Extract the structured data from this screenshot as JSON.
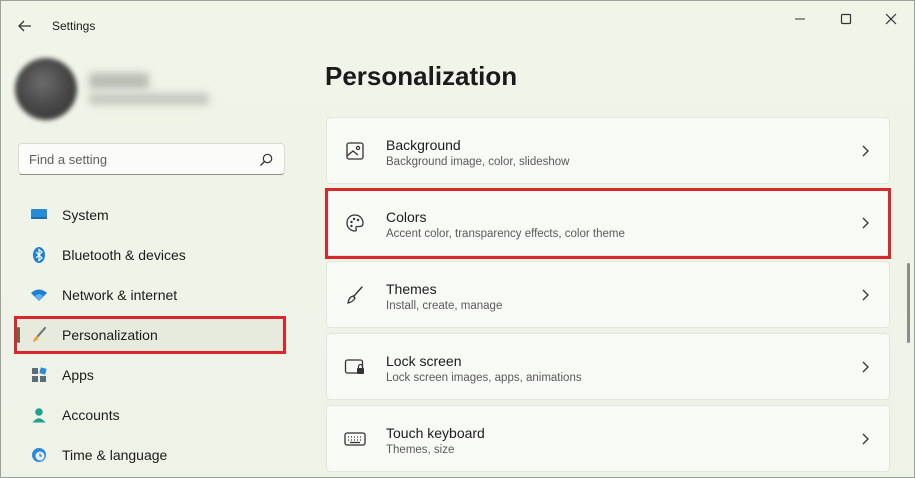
{
  "window": {
    "title": "Settings",
    "controls": {
      "minimize_icon": "minimize-icon",
      "maximize_icon": "maximize-icon",
      "close_icon": "close-icon"
    },
    "back_icon": "back-arrow-icon"
  },
  "search": {
    "placeholder": "Find a setting",
    "icon": "search-icon"
  },
  "sidebar": {
    "items": [
      {
        "label": "System",
        "icon": "system-icon",
        "selected": false
      },
      {
        "label": "Bluetooth & devices",
        "icon": "bluetooth-icon",
        "selected": false
      },
      {
        "label": "Network & internet",
        "icon": "wifi-icon",
        "selected": false
      },
      {
        "label": "Personalization",
        "icon": "brush-icon",
        "selected": true
      },
      {
        "label": "Apps",
        "icon": "apps-icon",
        "selected": false
      },
      {
        "label": "Accounts",
        "icon": "accounts-icon",
        "selected": false
      },
      {
        "label": "Time & language",
        "icon": "time-language-icon",
        "selected": false
      }
    ]
  },
  "main": {
    "title": "Personalization",
    "cards": [
      {
        "title": "Background",
        "subtitle": "Background image, color, slideshow",
        "icon": "image-icon"
      },
      {
        "title": "Colors",
        "subtitle": "Accent color, transparency effects, color theme",
        "icon": "palette-icon"
      },
      {
        "title": "Themes",
        "subtitle": "Install, create, manage",
        "icon": "brush-outline-icon"
      },
      {
        "title": "Lock screen",
        "subtitle": "Lock screen images, apps, animations",
        "icon": "lock-screen-icon"
      },
      {
        "title": "Touch keyboard",
        "subtitle": "Themes, size",
        "icon": "keyboard-icon"
      }
    ]
  },
  "colors": {
    "highlight": "#d8282b",
    "accent": "#0078d4",
    "background": "#eef3e6"
  }
}
